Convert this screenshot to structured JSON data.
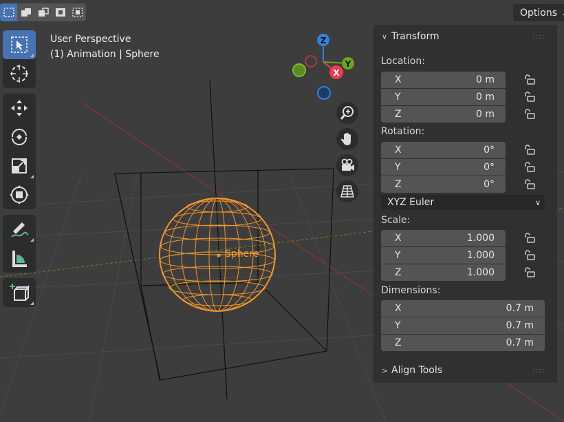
{
  "header": {
    "mode_buttons": [
      "select-new",
      "select-extend",
      "select-subtract",
      "select-invert",
      "select-intersect"
    ],
    "options_label": "Options"
  },
  "toolbar": {
    "tools": [
      "select-box",
      "cursor",
      "move",
      "rotate",
      "scale",
      "transform",
      "annotate",
      "measure",
      "add-cube"
    ]
  },
  "viewport": {
    "view_name": "User Perspective",
    "context_text": "(1) Animation | Sphere",
    "object_label": "Sphere",
    "gizmo": {
      "x": "X",
      "y": "Y",
      "z": "Z"
    },
    "colors": {
      "x_axis": "#ee3b4f",
      "y_axis": "#6ea517",
      "z_axis": "#2d84d9",
      "selection": "#f0962d"
    }
  },
  "sidebar": {
    "transform_title": "Transform",
    "location_label": "Location:",
    "location": [
      {
        "axis": "X",
        "value": "0 m"
      },
      {
        "axis": "Y",
        "value": "0 m"
      },
      {
        "axis": "Z",
        "value": "0 m"
      }
    ],
    "rotation_label": "Rotation:",
    "rotation": [
      {
        "axis": "X",
        "value": "0°"
      },
      {
        "axis": "Y",
        "value": "0°"
      },
      {
        "axis": "Z",
        "value": "0°"
      }
    ],
    "rotation_mode": "XYZ Euler",
    "scale_label": "Scale:",
    "scale": [
      {
        "axis": "X",
        "value": "1.000"
      },
      {
        "axis": "Y",
        "value": "1.000"
      },
      {
        "axis": "Z",
        "value": "1.000"
      }
    ],
    "dimensions_label": "Dimensions:",
    "dimensions": [
      {
        "axis": "X",
        "value": "0.7 m"
      },
      {
        "axis": "Y",
        "value": "0.7 m"
      },
      {
        "axis": "Z",
        "value": "0.7 m"
      }
    ],
    "align_tools_title": "Align Tools",
    "grip": "::::"
  }
}
